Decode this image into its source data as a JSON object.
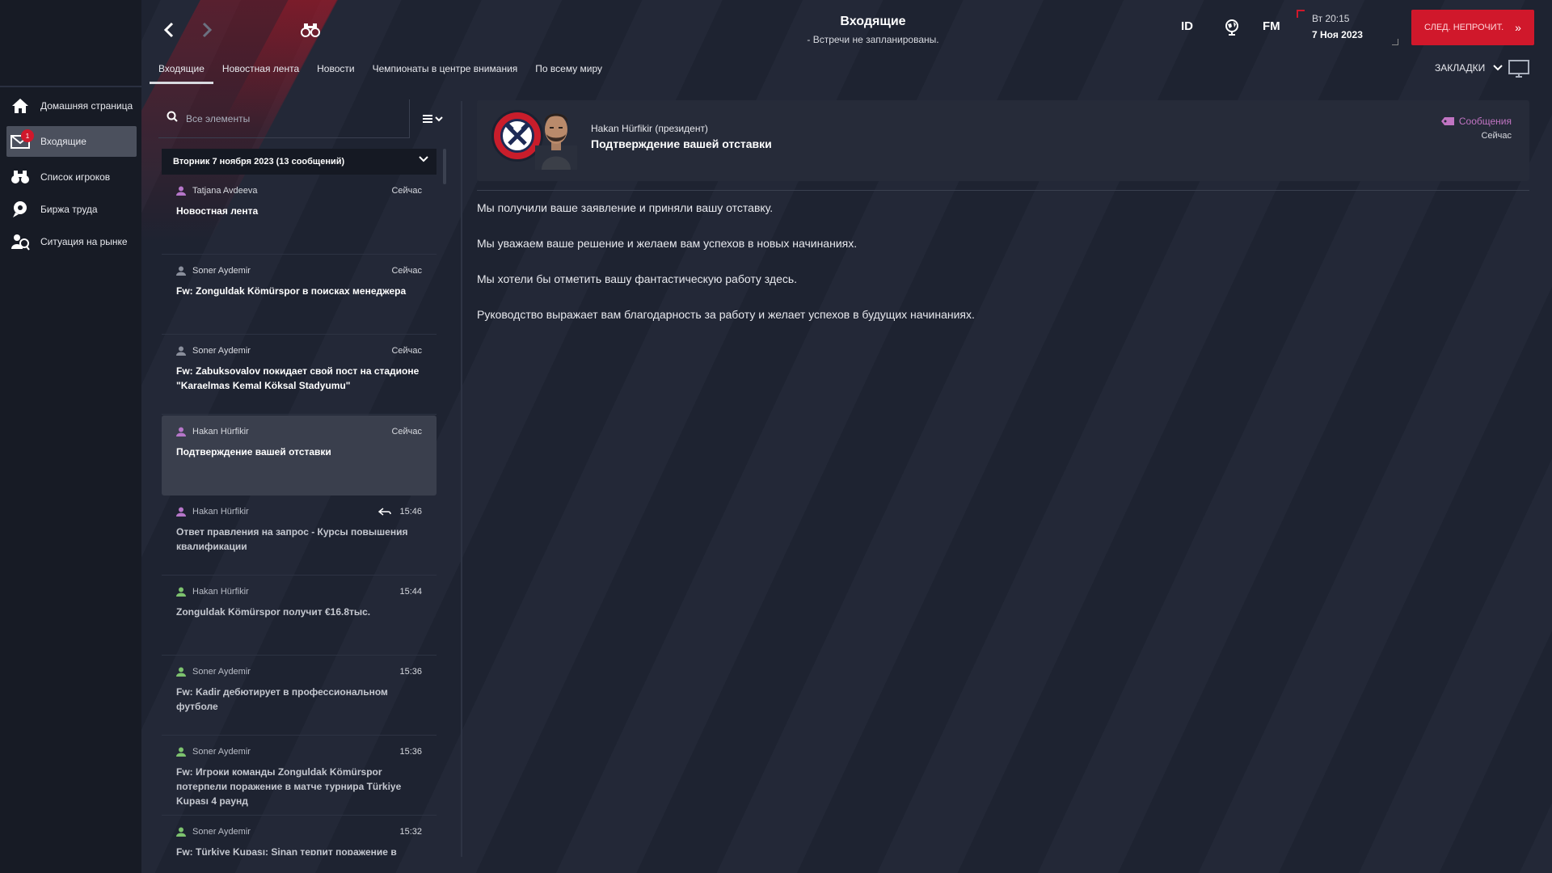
{
  "header": {
    "title": "Входящие",
    "subtitle": "- Встречи не запланированы.",
    "id_label": "ID",
    "fm_label": "FM",
    "day_time": "Вт 20:15",
    "date": "7 Ноя 2023",
    "next_button": "СЛЕД. НЕПРОЧИТ."
  },
  "sidebar": {
    "items": [
      {
        "label": "Домашняя страница",
        "icon": "home-icon"
      },
      {
        "label": "Входящие",
        "icon": "inbox-icon",
        "badge": "1"
      },
      {
        "label": "Список игроков",
        "icon": "binoculars-icon"
      },
      {
        "label": "Биржа труда",
        "icon": "job-icon"
      },
      {
        "label": "Ситуация на рынке",
        "icon": "market-icon"
      }
    ]
  },
  "tabs": [
    "Входящие",
    "Новостная лента",
    "Новости",
    "Чемпионаты в центре внимания",
    "По всему миру"
  ],
  "bookmarks_label": "ЗАКЛАДКИ",
  "search": {
    "placeholder": "Все элементы"
  },
  "group_header": "Вторник 7 ноября 2023 (13 сообщений)",
  "messages": [
    {
      "sender": "Tatjana Avdeeva",
      "time": "Сейчас",
      "subject": "Новостная лента"
    },
    {
      "sender": "Soner Aydemir",
      "time": "Сейчас",
      "subject": "Fw: Zonguldak Kömürspor в поисках менеджера"
    },
    {
      "sender": "Soner Aydemir",
      "time": "Сейчас",
      "subject": "Fw: Zabuksovalov покидает свой пост на стадионе \"Karaelmas Kemal Köksal Stadyumu\""
    },
    {
      "sender": "Hakan Hürfikir",
      "time": "Сейчас",
      "subject": "Подтверждение вашей отставки"
    },
    {
      "sender": "Hakan Hürfikir",
      "time": "15:46",
      "subject": "Ответ правления на запрос - Курсы повышения квалификации"
    },
    {
      "sender": "Hakan Hürfikir",
      "time": "15:44",
      "subject": "Zonguldak Kömürspor получит €16.8тыс."
    },
    {
      "sender": "Soner Aydemir",
      "time": "15:36",
      "subject": "Fw: Kadir дебютирует в профессиональном футболе"
    },
    {
      "sender": "Soner Aydemir",
      "time": "15:36",
      "subject": "Fw: Игроки команды Zonguldak Kömürspor потерпели поражение в матче турнира Türkiye Kupası 4 раунд"
    },
    {
      "sender": "Soner Aydemir",
      "time": "15:32",
      "subject": "Fw: Türkiye Kupası: Sinan терпит поражение в"
    }
  ],
  "detail": {
    "sender": "Hakan Hürfikir  (президент)",
    "subject": "Подтверждение вашей отставки",
    "tag": "Сообщения",
    "time": "Сейчас",
    "paragraphs": [
      "Мы получили ваше заявление и приняли вашу отставку.",
      "Мы уважаем ваше решение и желаем вам успехов в новых начинаниях.",
      "Мы хотели бы отметить вашу фантастическую работу здесь.",
      "Руководство выражает вам благодарность за работу и желает успехов в будущих начинаниях."
    ]
  },
  "colors": {
    "accent": "#d0182b",
    "background": "#1f2433",
    "sidebar": "#171b25",
    "tag": "#c074c2"
  }
}
